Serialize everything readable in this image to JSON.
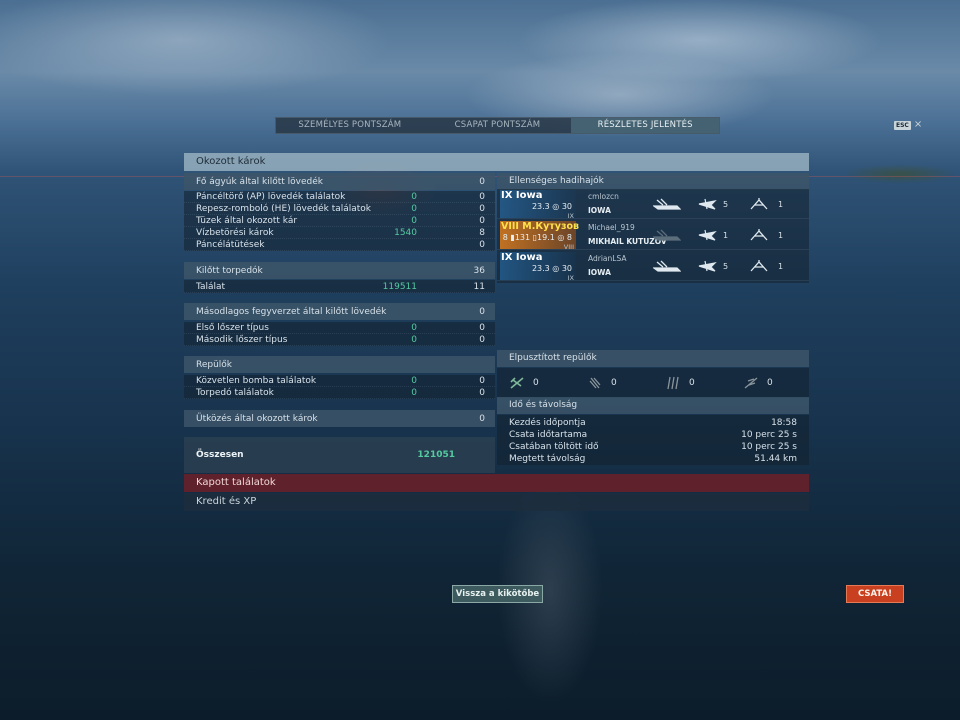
{
  "tabs": [
    {
      "label": "SZEMÉLYES PONTSZÁM"
    },
    {
      "label": "CSAPAT PONTSZÁM"
    },
    {
      "label": "RÉSZLETES JELENTÉS"
    }
  ],
  "esc": {
    "key": "ESC",
    "close": "×"
  },
  "panel_title": "Okozott károk",
  "left": {
    "main_guns": {
      "title": "Fő ágyúk által kilőtt lövedék",
      "value": "0",
      "rows": [
        {
          "label": "Páncéltörő (AP) lövedék találatok",
          "v1": "0",
          "v2": "0"
        },
        {
          "label": "Repesz-romboló (HE) lövedék találatok",
          "v1": "0",
          "v2": "0"
        },
        {
          "label": "Tüzek által okozott kár",
          "v1": "0",
          "v2": "0"
        },
        {
          "label": "Vízbetörési károk",
          "v1": "1540",
          "v2": "8"
        },
        {
          "label": "Páncélátütések",
          "v1": "",
          "v2": "0"
        }
      ]
    },
    "torpedoes": {
      "title": "Kilőtt torpedók",
      "value": "36",
      "rows": [
        {
          "label": "Találat",
          "v1": "119511",
          "v2": "11"
        }
      ]
    },
    "secondary": {
      "title": "Másodlagos fegyverzet által kilőtt lövedék",
      "value": "0",
      "rows": [
        {
          "label": "Első lőszer típus",
          "v1": "0",
          "v2": "0"
        },
        {
          "label": "Második lőszer típus",
          "v1": "0",
          "v2": "0"
        }
      ]
    },
    "aircraft": {
      "title": "Repülők",
      "value": "",
      "rows": [
        {
          "label": "Közvetlen bomba találatok",
          "v1": "0",
          "v2": "0"
        },
        {
          "label": "Torpedó találatok",
          "v1": "0",
          "v2": "0"
        }
      ]
    },
    "ramming": {
      "title": "Ütközés által okozott károk",
      "value": "0"
    },
    "total": {
      "label": "Összesen",
      "value": "121051"
    }
  },
  "right": {
    "enemies_title": "Ellenséges hadihajók",
    "enemies": [
      {
        "name": "IX Iowa",
        "stats": "23.3 ◎ 30",
        "tier": "IX",
        "player": "cmlozcn",
        "ship": "IOWA",
        "c1": "5",
        "c2": "1",
        "style": "blue"
      },
      {
        "name": "VIII M.Кутузов",
        "stats": "8 ▮131 ▯19.1 ◎ 8",
        "tier": "VIII",
        "player": "Michael_919",
        "ship": "MIKHAIL KUTUZOV",
        "c1": "1",
        "c2": "1",
        "style": "gold"
      },
      {
        "name": "IX Iowa",
        "stats": "23.3 ◎ 30",
        "tier": "IX",
        "player": "AdrianLSA",
        "ship": "IOWA",
        "c1": "5",
        "c2": "1",
        "style": "blue"
      }
    ],
    "planes_title": "Elpusztított repülők",
    "planes": [
      {
        "icon": "fighter-icon",
        "count": "0"
      },
      {
        "icon": "bomber-icon",
        "count": "0"
      },
      {
        "icon": "torpedo-bomber-icon",
        "count": "0"
      },
      {
        "icon": "spotter-icon",
        "count": "0"
      }
    ],
    "time_title": "Idő és távolság",
    "time_rows": [
      {
        "label": "Kezdés időpontja",
        "value": "18:58"
      },
      {
        "label": "Csata időtartama",
        "value": "10 perc 25 s"
      },
      {
        "label": "Csatában töltött idő",
        "value": "10 perc 25 s"
      },
      {
        "label": "Megtett távolság",
        "value": "51.44 km"
      }
    ]
  },
  "kapott": "Kapott találatok",
  "kredit": "Kredit és XP",
  "buttons": {
    "back": "Vissza a kikötőbe",
    "fight": "CSATA!"
  },
  "colors": {
    "accent_green": "#55c9a0",
    "danger_red": "#c8401f",
    "header_blue": "#3c5569"
  }
}
